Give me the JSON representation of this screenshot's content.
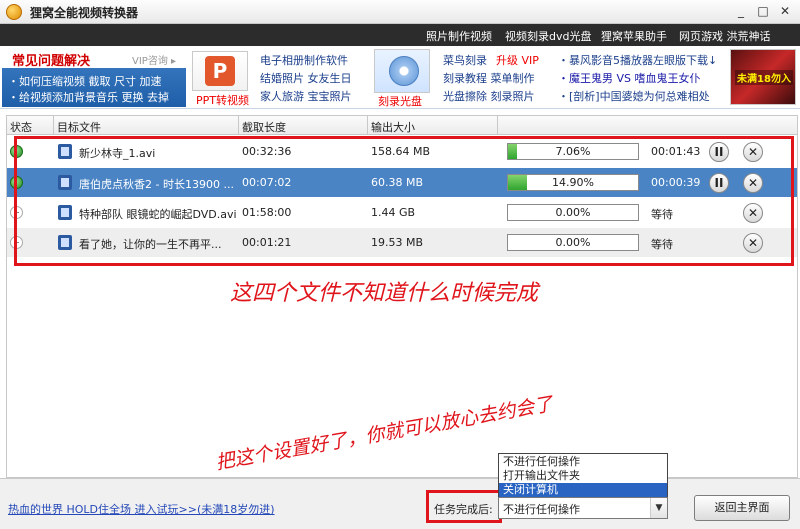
{
  "window": {
    "title": "狸窝全能视频转换器",
    "min": "_",
    "max": "□",
    "close": "✕"
  },
  "toplinks": [
    "照片制作视频",
    "视频刻录dvd光盘",
    "狸窝苹果助手",
    "网页游戏 洪荒神话"
  ],
  "ads": {
    "faq_title": "常见问题解决",
    "faq_vip": "VIP咨询 ▸",
    "faq_line1": "・如何压缩视频 截取 尺寸 加速",
    "faq_line2": "・给视频添加背景音乐 更换 去掉",
    "ppt_caption": "PPT转视频",
    "col2": [
      "电子相册制作软件",
      "结婚照片 女友生日",
      "家人旅游 宝宝照片"
    ],
    "cd_caption": "刻录光盘",
    "col3_line1a": "菜鸟刻录",
    "col3_line1b": "升级 VIP",
    "col3_line2": "刻录教程 菜单制作",
    "col3_line3": "光盘擦除 刻录照片",
    "col4_line1": "・暴风影音5播放器左眼版下载↓",
    "col4_line2": "・魔王鬼男 VS 嗜血鬼王女仆",
    "col4_line3": "・[剖析]中国婆媳为何总难相处",
    "game_caption": "未满18勿入"
  },
  "table": {
    "headers": {
      "status": "状态",
      "file": "目标文件",
      "duration": "截取长度",
      "size": "输出大小"
    },
    "rows": [
      {
        "name": "新少林寺_1.avi",
        "duration": "00:32:36",
        "size": "158.64 MB",
        "progress": 0.0706,
        "progress_label": "7.06%",
        "eta": "00:01:43",
        "state": "active"
      },
      {
        "name": "唐伯虎点秋香2 - 时长13900 ...",
        "duration": "00:07:02",
        "size": "60.38 MB",
        "progress": 0.149,
        "progress_label": "14.90%",
        "eta": "00:00:39",
        "state": "active"
      },
      {
        "name": "特种部队 眼镜蛇的崛起DVD.avi",
        "duration": "01:58:00",
        "size": "1.44 GB",
        "progress": 0,
        "progress_label": "0.00%",
        "eta": "等待",
        "state": "waiting"
      },
      {
        "name": "看了她，让你的一生不再平...",
        "duration": "00:01:21",
        "size": "19.53 MB",
        "progress": 0,
        "progress_label": "0.00%",
        "eta": "等待",
        "state": "waiting"
      }
    ],
    "pause_symbol": "II",
    "remove_symbol": "✕"
  },
  "annotations": {
    "note1": "这四个文件不知道什么时候完成",
    "note2": "把这个设置好了，你就可以放心去约会了"
  },
  "bottom": {
    "promo": "热血的世界 HOLD住全场 进入试玩>>(未满18岁勿进)",
    "task_label": "任务完成后:",
    "select_value": "不进行任何操作",
    "options": [
      "不进行任何操作",
      "打开输出文件夹",
      "关闭计算机"
    ],
    "highlighted_option": "关闭计算机",
    "back_button": "返回主界面",
    "arrow": "▼"
  },
  "colors": {
    "annotation_red": "#e0151c",
    "selected_row": "#4a84c5",
    "progress_green": "#2fa52f"
  }
}
